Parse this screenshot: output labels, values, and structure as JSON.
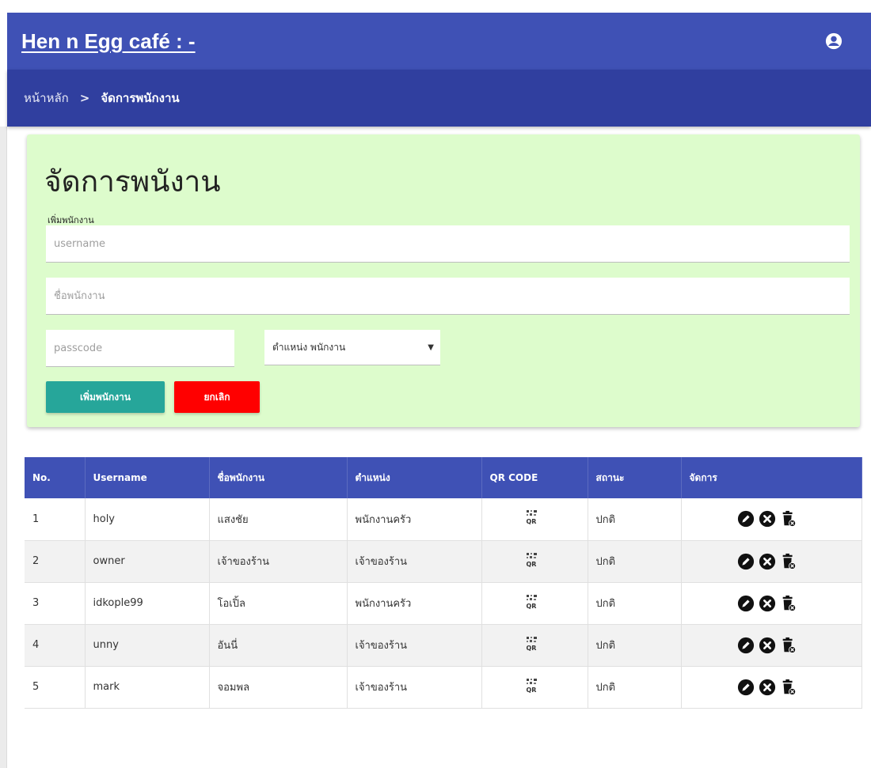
{
  "app": {
    "title": "Hen n Egg café : -"
  },
  "breadcrumb": {
    "home": "หน้าหลัก",
    "separator": ">",
    "current": "จัดการพนักงาน"
  },
  "form": {
    "heading": "จัดการพนังาน",
    "sublabel": "เพิ่มพนักงาน",
    "username_placeholder": "username",
    "name_placeholder": "ชื่อพนักงาน",
    "passcode_placeholder": "passcode",
    "position_select": "ตำแหน่ง พนักงาน",
    "add_button": "เพิ่มพนักงาน",
    "cancel_button": "ยกเลิก"
  },
  "table": {
    "headers": [
      "No.",
      "Username",
      "ชื่อพนักงาน",
      "ตำแหน่ง",
      "QR CODE",
      "สถานะ",
      "จัดการ"
    ],
    "rows": [
      {
        "no": "1",
        "username": "holy",
        "name": "แสงชัย",
        "position": "พนักงานครัว",
        "status": "ปกติ"
      },
      {
        "no": "2",
        "username": "owner",
        "name": "เจ้าของร้าน",
        "position": "เจ้าของร้าน",
        "status": "ปกติ"
      },
      {
        "no": "3",
        "username": "idkople99",
        "name": "โอเปิ้ล",
        "position": "พนักงานครัว",
        "status": "ปกติ"
      },
      {
        "no": "4",
        "username": "unny",
        "name": "อันนี่",
        "position": "เจ้าของร้าน",
        "status": "ปกติ"
      },
      {
        "no": "5",
        "username": "mark",
        "name": "จอมพล",
        "position": "เจ้าของร้าน",
        "status": "ปกติ"
      }
    ]
  },
  "icons": {
    "account": "account-circle-icon",
    "qr": "qr-code-icon",
    "edit": "edit-icon",
    "disable": "cancel-circle-icon",
    "delete": "delete-icon"
  },
  "colors": {
    "appbar": "#3f51b5",
    "breadcrumb_bar": "#303f9f",
    "card_bg": "#ddfccc",
    "add_button": "#26a69a",
    "cancel_button": "#ff0000",
    "table_header": "#3f51b5"
  }
}
